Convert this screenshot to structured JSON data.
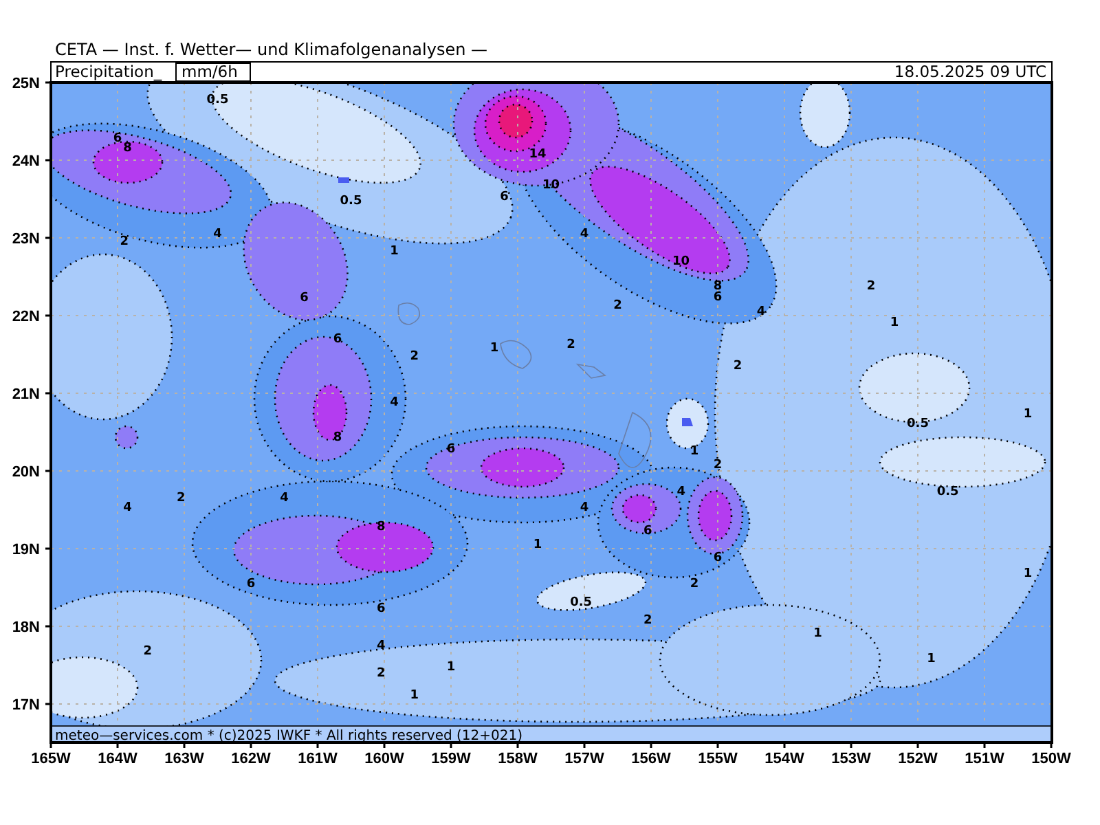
{
  "header": "CETA — Inst. f. Wetter— und Klimafolgenanalysen —",
  "title_bar": {
    "title": "Precipitation_",
    "units": "mm/6h",
    "valid_time": "18.05.2025  09  UTC"
  },
  "map": {
    "y_ticks": [
      "25N",
      "24N",
      "23N",
      "22N",
      "21N",
      "20N",
      "19N",
      "18N",
      "17N"
    ],
    "x_ticks": [
      "165W",
      "164W",
      "163W",
      "162W",
      "161W",
      "160W",
      "159W",
      "158W",
      "157W",
      "156W",
      "155W",
      "154W",
      "153W",
      "152W",
      "151W",
      "150W"
    ],
    "contour_labels": [
      "0.5",
      "6",
      "8",
      "14",
      "10",
      "0.5",
      "6",
      "4",
      "2",
      "1",
      "4",
      "10",
      "6",
      "8",
      "6",
      "2",
      "4",
      "2",
      "1",
      "6",
      "1",
      "2",
      "2",
      "2",
      "1",
      "4",
      "0.5",
      "8",
      "1",
      "6",
      "2",
      "4",
      "0.5",
      "4",
      "2",
      "4",
      "4",
      "6",
      "8",
      "1",
      "6",
      "6",
      "2",
      "0.5",
      "1",
      "6",
      "2",
      "1",
      "4",
      "2",
      "1",
      "2",
      "1",
      "1"
    ]
  },
  "footer": "meteo—services.com * (c)2025 IWKF * All rights reserved (12+021)"
}
